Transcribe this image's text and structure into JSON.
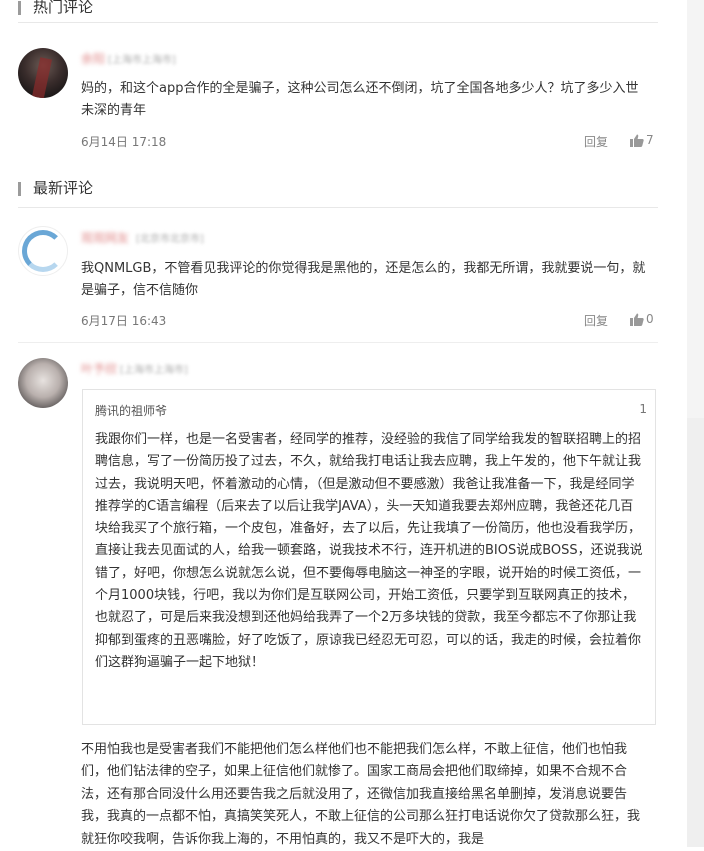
{
  "hot_section": {
    "title": "热门评论"
  },
  "latest_section": {
    "title": "最新评论"
  },
  "hot_comments": [
    {
      "username": "余阳",
      "location": "[上海市上海市]",
      "text": "妈的，和这个app合作的全是骗子，这种公司怎么还不倒闭，坑了全国各地多少人？坑了多少入世未深的青年",
      "time": "6月14日 17:18",
      "reply_label": "回复",
      "likes": "7"
    }
  ],
  "latest_comments": [
    {
      "username": "观观网友",
      "location": "[北京市北京市]",
      "text": "我QNMLGB，不管看见我评论的你觉得我是黑他的，还是怎么的，我都无所谓，我就要说一句，就是骗子，信不信随你",
      "time": "6月17日 16:43",
      "reply_label": "回复",
      "likes": "0"
    },
    {
      "username": "叶予欣",
      "location": "[上海市上海市]",
      "quote": {
        "author": "腾讯的祖师爷",
        "floor": "1",
        "text": "我跟你们一样，也是一名受害者，经同学的推荐，没经验的我信了同学给我发的智联招聘上的招聘信息，写了一份简历投了过去，不久，就给我打电话让我去应聘，我上午发的，他下午就让我过去，我说明天吧，怀着激动的心情，（但是激动但不要感激）我爸让我准备一下，我是经同学推荐学的C语言编程（后来去了以后让我学JAVA），头一天知道我要去郑州应聘，我爸还花几百块给我买了个旅行箱，一个皮包，准备好，去了以后，先让我填了一份简历，他也没看我学历，直接让我去见面试的人，给我一顿套路，说我技术不行，连开机进的BIOS说成BOSS，还说我说错了，好吧，你想怎么说就怎么说，但不要侮辱电脑这一神圣的字眼，说开始的时候工资低，一个月1000块钱，行吧，我以为你们是互联网公司，开始工资低，只要学到互联网真正的技术，也就忍了，可是后来我没想到还他妈给我弄了一个2万多块钱的贷款，我至今都忘不了你那让我抑郁到蛋疼的丑恶嘴脸，好了吃饭了，原谅我已经忍无可忍，可以的话，我走的时候，会拉着你们这群狗逼骗子一起下地狱！"
      },
      "text": "不用怕我也是受害者我们不能把他们怎么样他们也不能把我们怎么样，不敢上征信，他们也怕我们，他们钻法律的空子，如果上征信他们就惨了。国家工商局会把他们取缔掉，如果不合规不合法，还有那合同没什么用还要告我之后就没用了，还微信加我直接给黑名单删掉，发消息说要告我，我真的一点都不怕，真搞笑笑死人，不敢上征信的公司那么狂打电话说你欠了贷款那么狂，我就狂你咬我啊，告诉你我上海的，不用怕真的，我又不是吓大的，我是"
    }
  ],
  "icons": {
    "like": "thumbs-up-icon"
  },
  "colors": {
    "section_bar": "#9b9b9b",
    "username": "#e08a8a",
    "text": "#333333",
    "meta": "#777777"
  }
}
